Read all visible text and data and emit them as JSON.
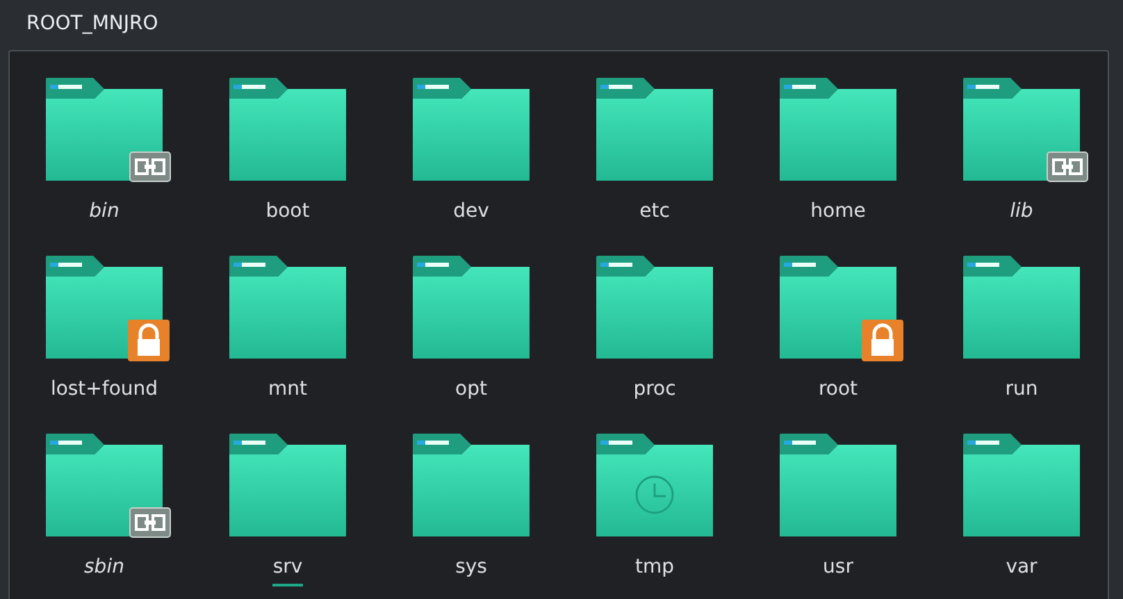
{
  "window": {
    "title": "ROOT_MNJRO"
  },
  "items": [
    {
      "name": "bin",
      "kind": "link",
      "focused": false
    },
    {
      "name": "boot",
      "kind": "plain",
      "focused": false
    },
    {
      "name": "dev",
      "kind": "plain",
      "focused": false
    },
    {
      "name": "etc",
      "kind": "plain",
      "focused": false
    },
    {
      "name": "home",
      "kind": "plain",
      "focused": false
    },
    {
      "name": "lib",
      "kind": "link",
      "focused": false
    },
    {
      "name": "lost+found",
      "kind": "lock",
      "focused": false
    },
    {
      "name": "mnt",
      "kind": "plain",
      "focused": false
    },
    {
      "name": "opt",
      "kind": "plain",
      "focused": false
    },
    {
      "name": "proc",
      "kind": "plain",
      "focused": false
    },
    {
      "name": "root",
      "kind": "lock",
      "focused": false
    },
    {
      "name": "run",
      "kind": "plain",
      "focused": false
    },
    {
      "name": "sbin",
      "kind": "link",
      "focused": false
    },
    {
      "name": "srv",
      "kind": "plain",
      "focused": true
    },
    {
      "name": "sys",
      "kind": "plain",
      "focused": false
    },
    {
      "name": "tmp",
      "kind": "clock",
      "focused": false
    },
    {
      "name": "usr",
      "kind": "plain",
      "focused": false
    },
    {
      "name": "var",
      "kind": "plain",
      "focused": false
    }
  ]
}
